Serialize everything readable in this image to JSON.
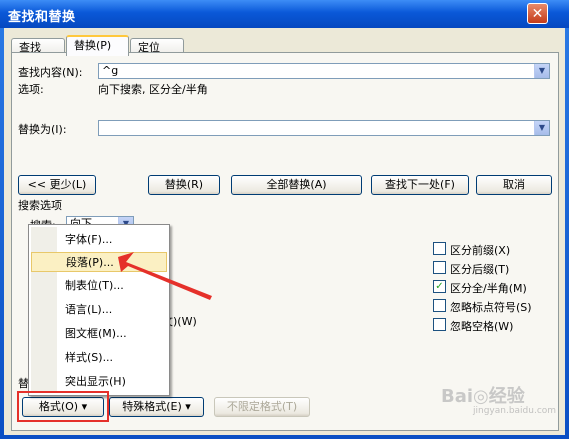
{
  "window": {
    "title": "查找和替换",
    "close_glyph": "✕"
  },
  "tabs": [
    {
      "label": "查找(D)"
    },
    {
      "label": "替换(P)"
    },
    {
      "label": "定位(G)"
    }
  ],
  "find": {
    "label": "查找内容(N):",
    "value": "^g",
    "options_label": "选项:",
    "options_value": "向下搜索, 区分全/半角"
  },
  "replace": {
    "label": "替换为(I):",
    "value": ""
  },
  "buttons": {
    "less": "<< 更少(L)",
    "replace": "替换(R)",
    "replace_all": "全部替换(A)",
    "find_next": "查找下一处(F)",
    "cancel": "取消",
    "format": "格式(O) ▾",
    "special": "特殊格式(E) ▾",
    "no_format": "不限定格式(T)"
  },
  "search_options": {
    "title": "搜索选项",
    "search_label": "搜索:",
    "search_value": "向下",
    "partial_text": "文)(W)",
    "replace_section_stub": "替"
  },
  "checkboxes": [
    {
      "label": "区分前缀(X)",
      "checked": false
    },
    {
      "label": "区分后缀(T)",
      "checked": false
    },
    {
      "label": "区分全/半角(M)",
      "checked": true
    },
    {
      "label": "忽略标点符号(S)",
      "checked": false
    },
    {
      "label": "忽略空格(W)",
      "checked": false
    }
  ],
  "format_menu": [
    {
      "label": "字体(F)..."
    },
    {
      "label": "段落(P)..."
    },
    {
      "label": "制表位(T)..."
    },
    {
      "label": "语言(L)..."
    },
    {
      "label": "图文框(M)..."
    },
    {
      "label": "样式(S)..."
    },
    {
      "label": "突出显示(H)"
    }
  ],
  "annotation": {
    "arrow_color": "#e5302a",
    "box_color": "#e5302a"
  },
  "watermark": {
    "brand": "Bai◎经验",
    "sub": "jingyan.baidu.com"
  }
}
